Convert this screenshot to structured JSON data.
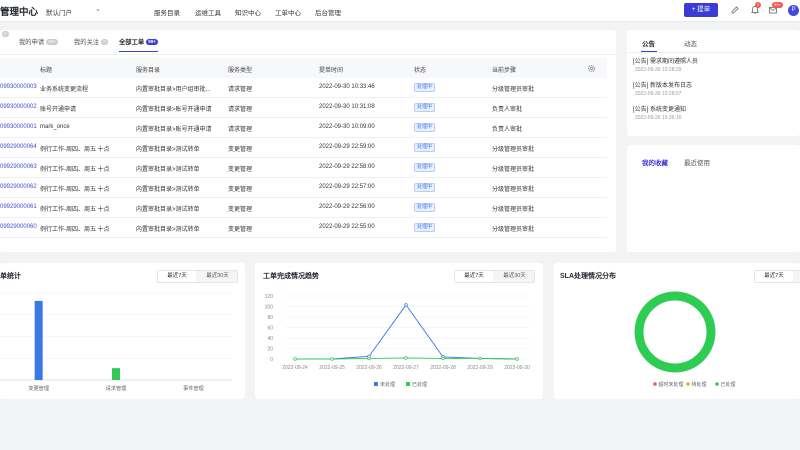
{
  "header": {
    "brand": "管理中心",
    "portal": "默认门户",
    "nav": [
      "服务目录",
      "运维工具",
      "知识中心",
      "工单中心",
      "后台管理"
    ],
    "submit_label": "+ 提单",
    "bell_badge": "2",
    "msg_badge": "99+",
    "avatar_letter": "P"
  },
  "tickets": {
    "tabs": [
      {
        "label": "我的申请",
        "count": "99+"
      },
      {
        "label": "我的关注",
        "count": "0"
      },
      {
        "label": "全部工单",
        "count": "99+"
      }
    ],
    "columns": [
      "标题",
      "服务目录",
      "服务类型",
      "提单时间",
      "状态",
      "当前步骤"
    ],
    "rows": [
      {
        "id": "09930000003",
        "title": "业务系统变更流程",
        "catalog": "内置审批目录>用户组审批...",
        "type": "请求管理",
        "time": "2022-09-30 10:33:46",
        "status": "处理中",
        "step": "分级管理员审批"
      },
      {
        "id": "09930000002",
        "title": "账号开通申请",
        "catalog": "内置审批目录>账号开通申请",
        "type": "请求管理",
        "time": "2022-09-30 10:31:08",
        "status": "处理中",
        "step": "负责人审批"
      },
      {
        "id": "09930000001",
        "title": "mark_once",
        "catalog": "内置审批目录>账号开通申请",
        "type": "请求管理",
        "time": "2022-09-30 10:09:00",
        "status": "处理中",
        "step": "负责人审批"
      },
      {
        "id": "09929000064",
        "title": "例行工作-周四、周五 十点",
        "catalog": "内置审批目录>测试转单",
        "type": "变更管理",
        "time": "2022-09-29 22:59:00",
        "status": "处理中",
        "step": "分级管理员审批"
      },
      {
        "id": "09929000063",
        "title": "例行工作-周四、周五 十点",
        "catalog": "内置审批目录>测试转单",
        "type": "变更管理",
        "time": "2022-09-29 22:58:00",
        "status": "处理中",
        "step": "分级管理员审批"
      },
      {
        "id": "09929000062",
        "title": "例行工作-周四、周五 十点",
        "catalog": "内置审批目录>测试转单",
        "type": "变更管理",
        "time": "2022-09-29 22:57:00",
        "status": "处理中",
        "step": "分级管理员审批"
      },
      {
        "id": "09929000061",
        "title": "例行工作-周四、周五 十点",
        "catalog": "内置审批目录>测试转单",
        "type": "变更管理",
        "time": "2022-09-29 22:56:00",
        "status": "处理中",
        "step": "分级管理员审批"
      },
      {
        "id": "09929000060",
        "title": "例行工作-周四、周五 十点",
        "catalog": "内置审批目录>测试转单",
        "type": "变更管理",
        "time": "2022-09-29 22:55:00",
        "status": "处理中",
        "step": "分级管理员审批"
      }
    ]
  },
  "right_panel": {
    "tabs": [
      "公告",
      "动态"
    ],
    "notices": [
      {
        "title": "[公告] 需求期间遵照人员",
        "time": "2022-09-30 10:28:29"
      },
      {
        "title": "[公告] 新版本发布日志",
        "time": "2022-09-30 10:28:07"
      },
      {
        "title": "[公告] 系统变更通知",
        "time": "2022-09-26 15:36:16"
      }
    ],
    "fav_tabs": [
      "我的收藏",
      "最近使用"
    ]
  },
  "stats_card": {
    "title": "单统计",
    "range": [
      "最近7天",
      "最近30天"
    ]
  },
  "trend_card": {
    "title": "工单完成情况趋势",
    "range": [
      "最近7天",
      "最近30天"
    ]
  },
  "sla_card": {
    "title": "SLA处理情况分布",
    "range": [
      "最近7天"
    ],
    "legend": [
      "超时未处理",
      "待处理",
      "已处理"
    ]
  },
  "colors": {
    "accent": "#3b3bd6",
    "bar_blue": "#3b78e7",
    "bar_green": "#34c759",
    "ring_green": "#2ecc52",
    "legend_red": "#f25b4b",
    "legend_orange": "#f5a623"
  },
  "chart_data": [
    {
      "type": "bar",
      "title": "单统计",
      "categories": [
        "变更管理",
        "请求管理",
        "事件管理"
      ],
      "series": [
        {
          "values": [
            100,
            0,
            0
          ]
        },
        {
          "values": [
            0,
            15,
            0
          ]
        }
      ]
    },
    {
      "type": "line",
      "title": "工单完成情况趋势",
      "x": [
        "2022-09-24",
        "2022-09-25",
        "2022-09-26",
        "2022-09-27",
        "2022-09-28",
        "2022-09-29",
        "2022-09-30"
      ],
      "ylim": [
        0,
        120
      ],
      "yticks": [
        0,
        20,
        40,
        60,
        80,
        100,
        120
      ],
      "series": [
        {
          "name": "未处理",
          "values": [
            0,
            0,
            5,
            103,
            4,
            1,
            0
          ]
        },
        {
          "name": "已处理",
          "values": [
            0,
            0,
            1,
            2,
            1,
            1,
            0
          ]
        }
      ]
    },
    {
      "type": "pie",
      "title": "SLA处理情况分布",
      "categories": [
        "超时未处理",
        "待处理",
        "已处理"
      ],
      "values": [
        0,
        0,
        100
      ]
    }
  ]
}
